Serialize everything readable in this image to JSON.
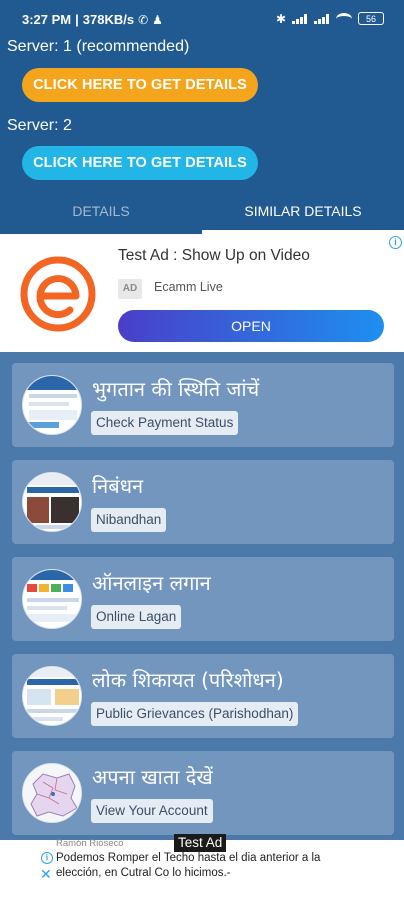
{
  "status": {
    "time": "3:27 PM",
    "speed": "378KB/s",
    "battery": "56"
  },
  "servers": [
    {
      "label": "Server: 1 (recommended)",
      "button": "CLICK HERE TO GET DETAILS"
    },
    {
      "label": "Server: 2",
      "button": "CLICK HERE TO GET DETAILS"
    }
  ],
  "tabs": [
    {
      "label": "DETAILS"
    },
    {
      "label": "SIMILAR DETAILS"
    }
  ],
  "ad": {
    "title": "Test Ad : Show Up on Video",
    "badge": "AD",
    "advertiser": "Ecamm Live",
    "cta": "OPEN"
  },
  "items": [
    {
      "title": "भुगतान की स्थिति जांचें",
      "subtitle": "Check Payment Status"
    },
    {
      "title": "निबंधन",
      "subtitle": "Nibandhan"
    },
    {
      "title": "ऑनलाइन लगान",
      "subtitle": "Online Lagan"
    },
    {
      "title": "लोक शिकायत (परिशोधन)",
      "subtitle": "Public Grievances (Parishodhan)"
    },
    {
      "title": "अपना खाता देखें",
      "subtitle": "View Your Account"
    }
  ],
  "bottom_ad": {
    "label": "Test Ad",
    "advertiser": "Ramón Rioseco",
    "text": "Podemos Romper el Techo hasta el dia anterior a la elección, en Cutral Co lo hicimos.-"
  },
  "colors": {
    "header": "#215a91",
    "list_background": "#4b79aa",
    "card": "#7396bf",
    "button_primary": "#f4a51c",
    "button_secondary": "#22b6e6",
    "ad_logo": "#f26522"
  }
}
